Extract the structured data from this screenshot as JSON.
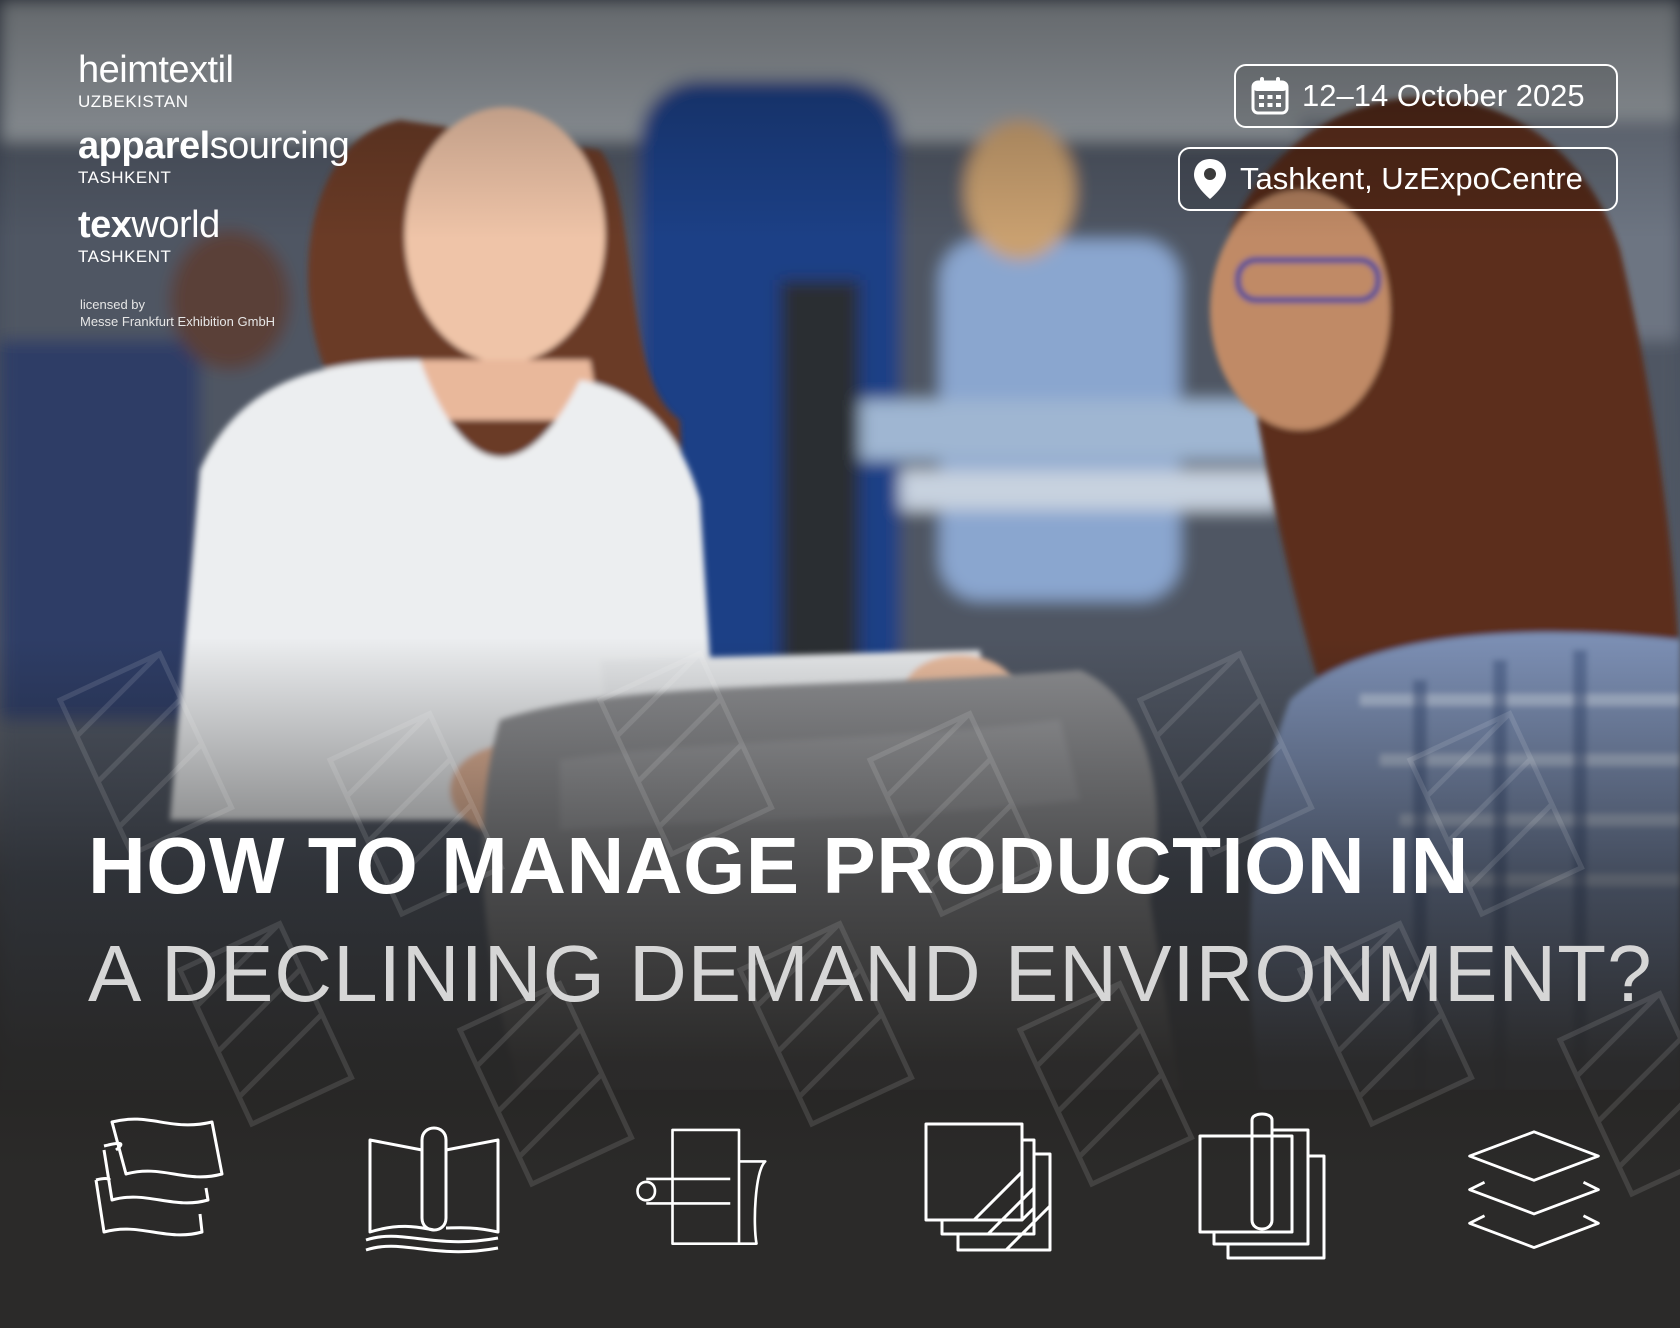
{
  "brands": [
    {
      "name_bold": "",
      "name_light": "heimtextil",
      "sub": "UZBEKISTAN"
    },
    {
      "name_bold": "apparel",
      "name_light": "sourcing",
      "sub": "TASHKENT"
    },
    {
      "name_bold": "tex",
      "name_light": "world",
      "sub": "TASHKENT"
    }
  ],
  "licensed": {
    "line1": "licensed by",
    "line2": "Messe Frankfurt Exhibition GmbH"
  },
  "event": {
    "date": "12–14 October 2025",
    "location": "Tashkent, UzExpoCentre"
  },
  "headline": {
    "line1": "HOW TO MANAGE PRODUCTION IN",
    "line2": "A DECLINING DEMAND ENVIRONMENT?"
  },
  "icons": [
    "fabric-swatches-icon",
    "fabric-roll-icon",
    "fabric-unroll-icon",
    "fabric-squares-icon",
    "fabric-sample-icon",
    "layers-icon"
  ],
  "colors": {
    "background": "#2b2a29",
    "text": "#ffffff",
    "headline_secondary": "#d6d6d6"
  }
}
